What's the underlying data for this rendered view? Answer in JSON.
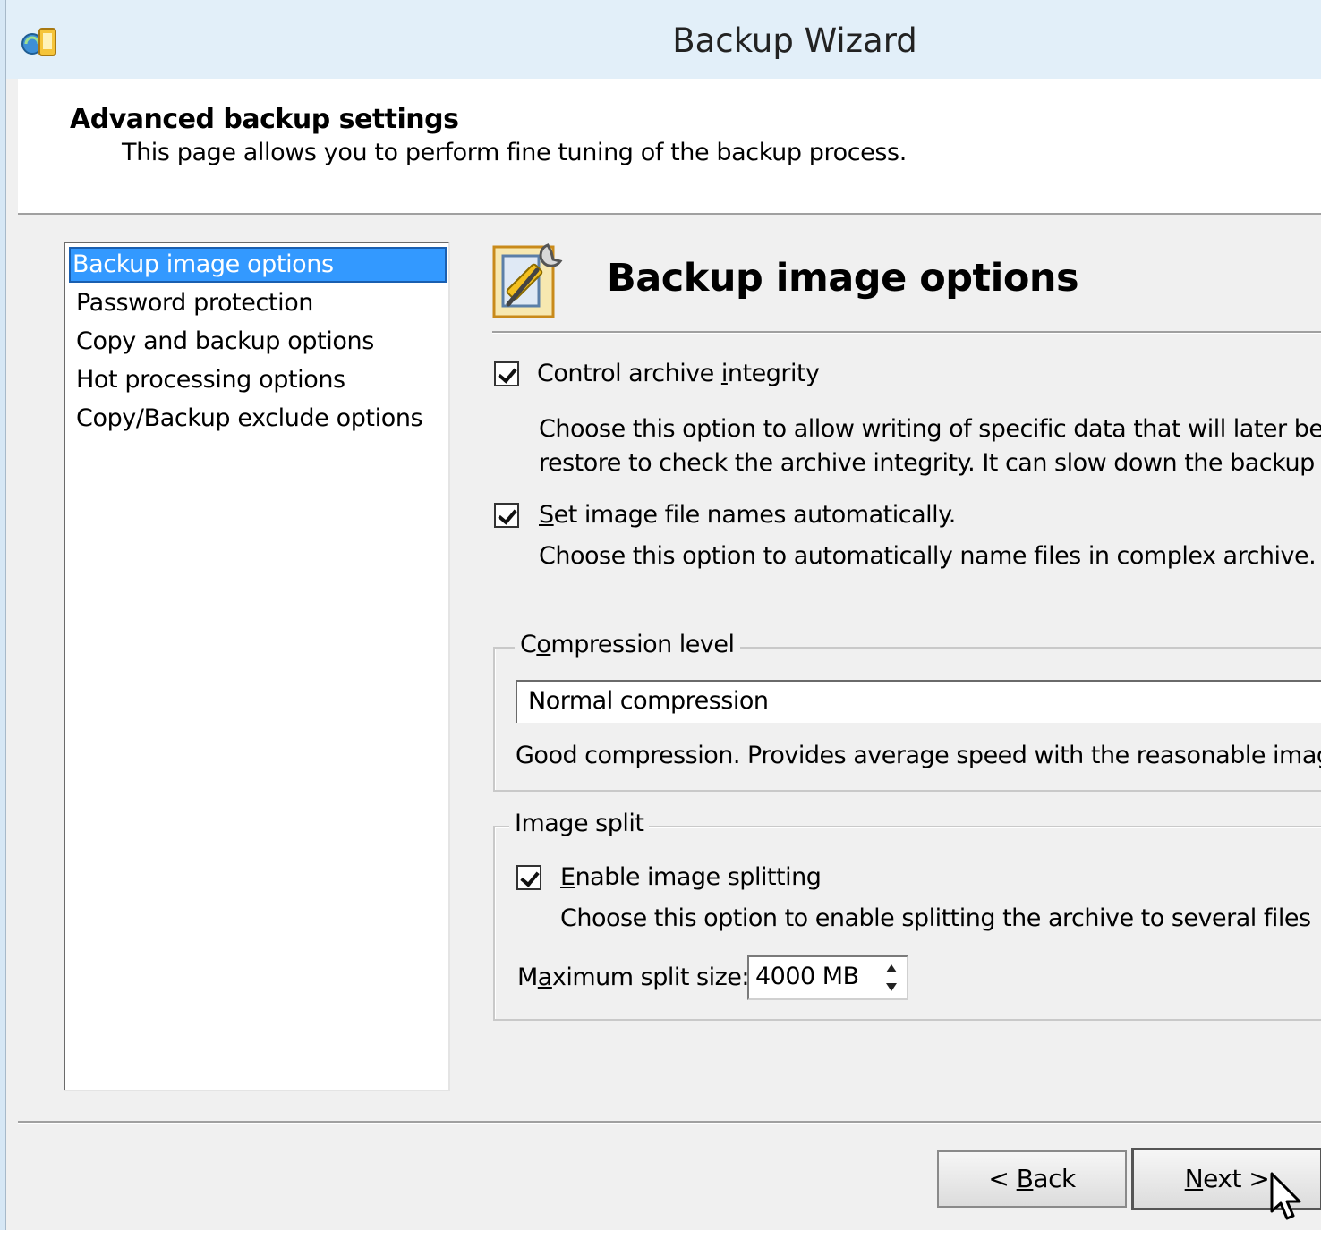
{
  "window": {
    "title": "Backup Wizard",
    "icon": "backup-wizard-app-icon"
  },
  "header": {
    "title": "Advanced backup settings",
    "subtitle": "This page allows you to perform fine tuning of the backup process."
  },
  "sidebar": {
    "items": [
      {
        "label": "Backup image options",
        "selected": true
      },
      {
        "label": "Password protection",
        "selected": false
      },
      {
        "label": "Copy and backup options",
        "selected": false
      },
      {
        "label": "Hot processing options",
        "selected": false
      },
      {
        "label": "Copy/Backup exclude options",
        "selected": false
      }
    ]
  },
  "content": {
    "title": "Backup image options",
    "icon": "settings-tools-icon",
    "options": [
      {
        "label_pre": "Control archive ",
        "label_u": "i",
        "label_post": "ntegrity",
        "checked": true,
        "desc_line1": "Choose this option to allow writing of specific data that will later be use",
        "desc_line2": "restore to check the archive integrity. It can slow down the backup op"
      },
      {
        "label_pre": "",
        "label_u": "S",
        "label_post": "et image file names automatically.",
        "checked": true,
        "desc_line1": "Choose this option to automatically name files in complex archive."
      }
    ],
    "compression": {
      "title_pre": "C",
      "title_u": "o",
      "title_post": "mpression level",
      "selected": "Normal compression",
      "description": "Good compression. Provides average speed with the reasonable image"
    },
    "split": {
      "title": "Image split",
      "enable_label_u": "E",
      "enable_label_post": "nable image splitting",
      "enable_checked": true,
      "enable_desc": "Choose this option to enable splitting the archive to several files",
      "max_label_pre": "M",
      "max_label_u": "a",
      "max_label_post": "ximum split size:",
      "max_value": "4000 MB"
    }
  },
  "footer": {
    "back_pre": "< ",
    "back_u": "B",
    "back_post": "ack",
    "next_pre": "",
    "next_u": "N",
    "next_post": "ext >"
  },
  "colors": {
    "selection": "#3399ff",
    "titlebar": "#e2eff9",
    "panel": "#f0f0f0"
  }
}
